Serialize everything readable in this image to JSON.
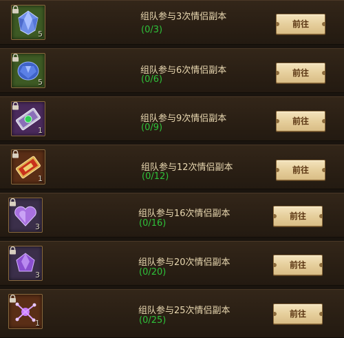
{
  "button_label": "前往",
  "tasks": [
    {
      "name": "组队参与3次情侣副本",
      "progress": "(0/3)",
      "count": "5",
      "icon": "blue-diamond-gem-icon"
    },
    {
      "name": "组队参与6次情侣副本",
      "progress": "(0/6)",
      "count": "5",
      "icon": "blue-gem-icon"
    },
    {
      "name": "组队参与9次情侣副本",
      "progress": "(0/9)",
      "count": "1",
      "icon": "purple-ticket-icon"
    },
    {
      "name": "组队参与12次情侣副本",
      "progress": "(0/12)",
      "count": "1",
      "icon": "red-ticket-icon"
    },
    {
      "name": "组队参与16次情侣副本",
      "progress": "(0/16)",
      "count": "3",
      "icon": "purple-heart-gem-icon"
    },
    {
      "name": "组队参与20次情侣副本",
      "progress": "(0/20)",
      "count": "3",
      "icon": "purple-gem-icon"
    },
    {
      "name": "组队参与25次情侣副本",
      "progress": "(0/25)",
      "count": "1",
      "icon": "purple-crystal-icon"
    }
  ],
  "colors": {
    "task_text": "#e8d7b0",
    "progress_text": "#2ec23a",
    "button_bg": "#e6cf9c",
    "button_text": "#5b3613",
    "row_bg": "#2a1f14"
  }
}
